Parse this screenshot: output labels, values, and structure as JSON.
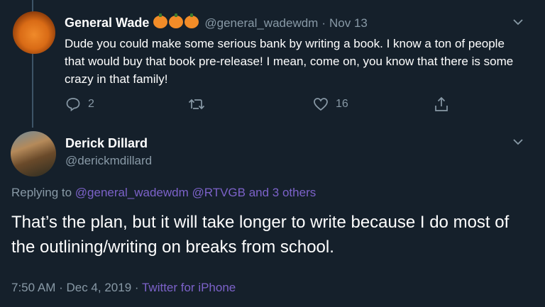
{
  "tweet1": {
    "name": "General Wade",
    "handle": "@general_wadewdm",
    "separator": "·",
    "date": "Nov 13",
    "text": "Dude you could make some serious bank by writing a book. I know a ton of people that would buy that book pre-release! I mean, come on, you know that there is some crazy in that family!",
    "reply_count": "2",
    "like_count": "16"
  },
  "tweet2": {
    "name": "Derick Dillard",
    "handle": "@derickmdillard",
    "replying_prefix": "Replying to",
    "replying_to": "@general_wadewdm @RTVGB and 3 others",
    "text": "That’s the plan, but it will take longer to write because I do most of the outlining/writing on breaks from school.",
    "timestamp": "7:50 AM · Dec 4, 2019 ·",
    "source": "Twitter for iPhone"
  },
  "icons": {
    "chevron": "chevron-down-icon",
    "reply": "reply-icon",
    "retweet": "retweet-icon",
    "like": "heart-icon",
    "share": "share-icon"
  },
  "colors": {
    "background": "#15202b",
    "muted": "#8899a6",
    "link": "#7c62c9"
  }
}
